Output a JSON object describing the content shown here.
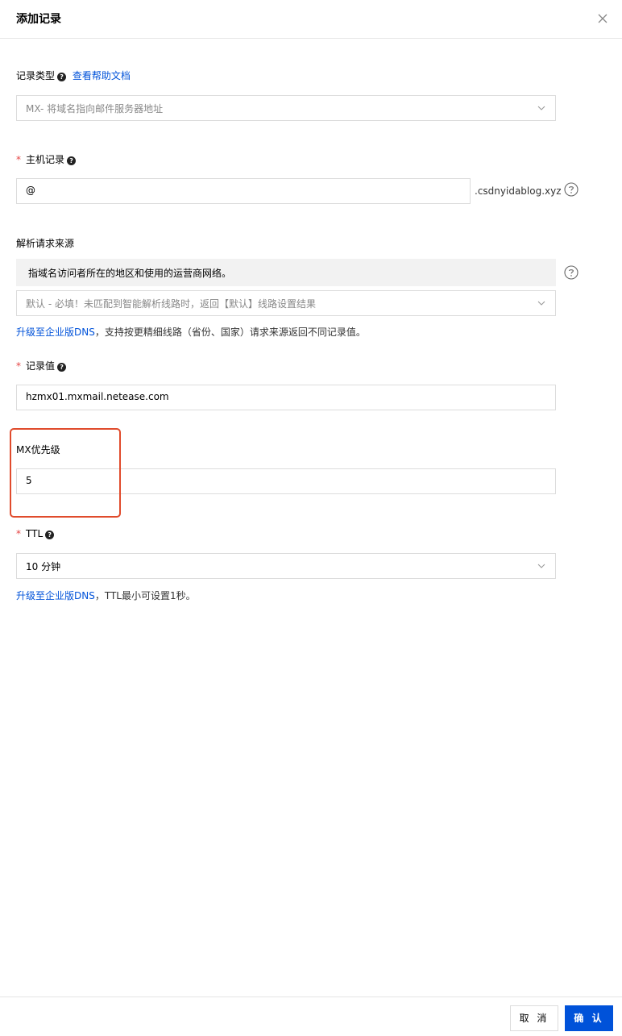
{
  "dialog": {
    "title": "添加记录"
  },
  "record_type": {
    "label": "记录类型",
    "help_link": "查看帮助文档",
    "value": "MX- 将域名指向邮件服务器地址"
  },
  "host_record": {
    "required_mark": "*",
    "label": "主机记录",
    "value": "@",
    "suffix": ".csdnyidablog.xyz"
  },
  "resolve_source": {
    "label": "解析请求来源",
    "info_text": "指域名访问者所在的地区和使用的运营商网络。",
    "select_value": "默认 - 必填！未匹配到智能解析线路时，返回【默认】线路设置结果",
    "upgrade_link": "升级至企业版DNS",
    "upgrade_note": "，支持按更精细线路（省份、国家）请求来源返回不同记录值。"
  },
  "record_value": {
    "required_mark": "*",
    "label": "记录值",
    "value": "hzmx01.mxmail.netease.com"
  },
  "mx_priority": {
    "label": "MX优先级",
    "value": "5"
  },
  "ttl": {
    "required_mark": "*",
    "label": "TTL",
    "value": "10 分钟",
    "upgrade_link": "升级至企业版DNS",
    "upgrade_note": "，TTL最小可设置1秒。"
  },
  "footer": {
    "cancel_label": "取 消",
    "confirm_label": "确 认"
  },
  "colors": {
    "link": "#0052d9",
    "required": "#e54545",
    "highlight": "#e04b2c",
    "primary_button": "#0052d9"
  }
}
